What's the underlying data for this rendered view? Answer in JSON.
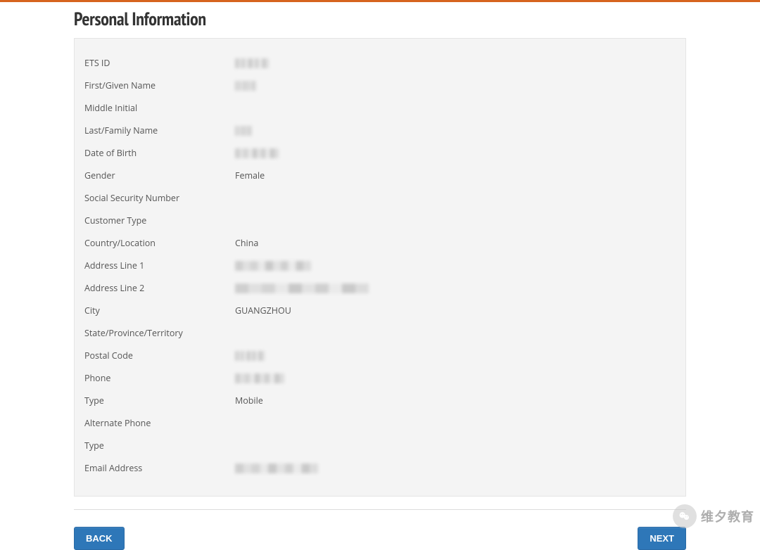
{
  "header": {
    "title": "Personal Information"
  },
  "personal_info": {
    "rows": [
      {
        "label": "ETS ID",
        "value": "",
        "redacted": true,
        "redact_w": 48
      },
      {
        "label": "First/Given Name",
        "value": "",
        "redacted": true,
        "redact_w": 30
      },
      {
        "label": "Middle Initial",
        "value": "",
        "redacted": false,
        "redact_w": 0
      },
      {
        "label": "Last/Family Name",
        "value": "",
        "redacted": true,
        "redact_w": 24
      },
      {
        "label": "Date of Birth",
        "value": "",
        "redacted": true,
        "redact_w": 62
      },
      {
        "label": "Gender",
        "value": "Female",
        "redacted": false,
        "redact_w": 0
      },
      {
        "label": "Social Security Number",
        "value": "",
        "redacted": false,
        "redact_w": 0
      },
      {
        "label": "Customer Type",
        "value": "",
        "redacted": false,
        "redact_w": 0
      },
      {
        "label": "Country/Location",
        "value": "China",
        "redacted": false,
        "redact_w": 0
      },
      {
        "label": "Address Line 1",
        "value": "",
        "redacted": true,
        "redact_w": 108
      },
      {
        "label": "Address Line 2",
        "value": "",
        "redacted": true,
        "redact_w": 190
      },
      {
        "label": "City",
        "value": "GUANGZHOU",
        "redacted": false,
        "redact_w": 0
      },
      {
        "label": "State/Province/Territory",
        "value": "",
        "redacted": false,
        "redact_w": 0
      },
      {
        "label": "Postal Code",
        "value": "",
        "redacted": true,
        "redact_w": 42
      },
      {
        "label": "Phone",
        "value": "",
        "redacted": true,
        "redact_w": 70
      },
      {
        "label": "Type",
        "value": "Mobile",
        "redacted": false,
        "redact_w": 0
      },
      {
        "label": "Alternate Phone",
        "value": "",
        "redacted": false,
        "redact_w": 0
      },
      {
        "label": "Type",
        "value": "",
        "redacted": false,
        "redact_w": 0
      },
      {
        "label": "Email Address",
        "value": "",
        "redacted": true,
        "redact_w": 118
      }
    ]
  },
  "footer": {
    "back_label": "BACK",
    "next_label": "NEXT"
  },
  "watermark": {
    "text": "维夕教育"
  }
}
